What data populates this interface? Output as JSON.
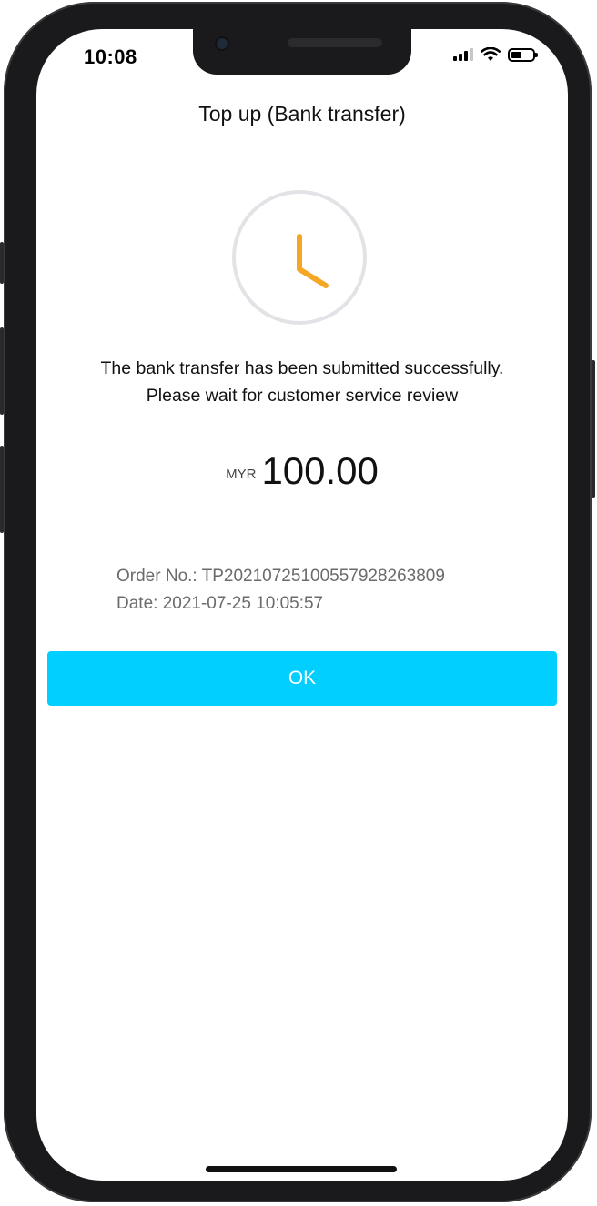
{
  "status_bar": {
    "time": "10:08"
  },
  "header": {
    "title": "Top up (Bank transfer)"
  },
  "icons": {
    "status": "clock-icon",
    "signal": "signal-icon",
    "wifi": "wifi-icon",
    "battery": "battery-icon"
  },
  "colors": {
    "accent": "#00cfff",
    "clock_hands": "#f5a623",
    "clock_ring": "#e3e3e7"
  },
  "message": {
    "line1": "The bank transfer has been submitted successfully.",
    "line2": "Please wait for customer service review"
  },
  "amount": {
    "currency": "MYR",
    "value": "100.00"
  },
  "order": {
    "order_no": "Order No.: TP202107251005579282638​09",
    "date": "Date: 2021-07-25 10:05:57"
  },
  "actions": {
    "ok_label": "OK"
  }
}
